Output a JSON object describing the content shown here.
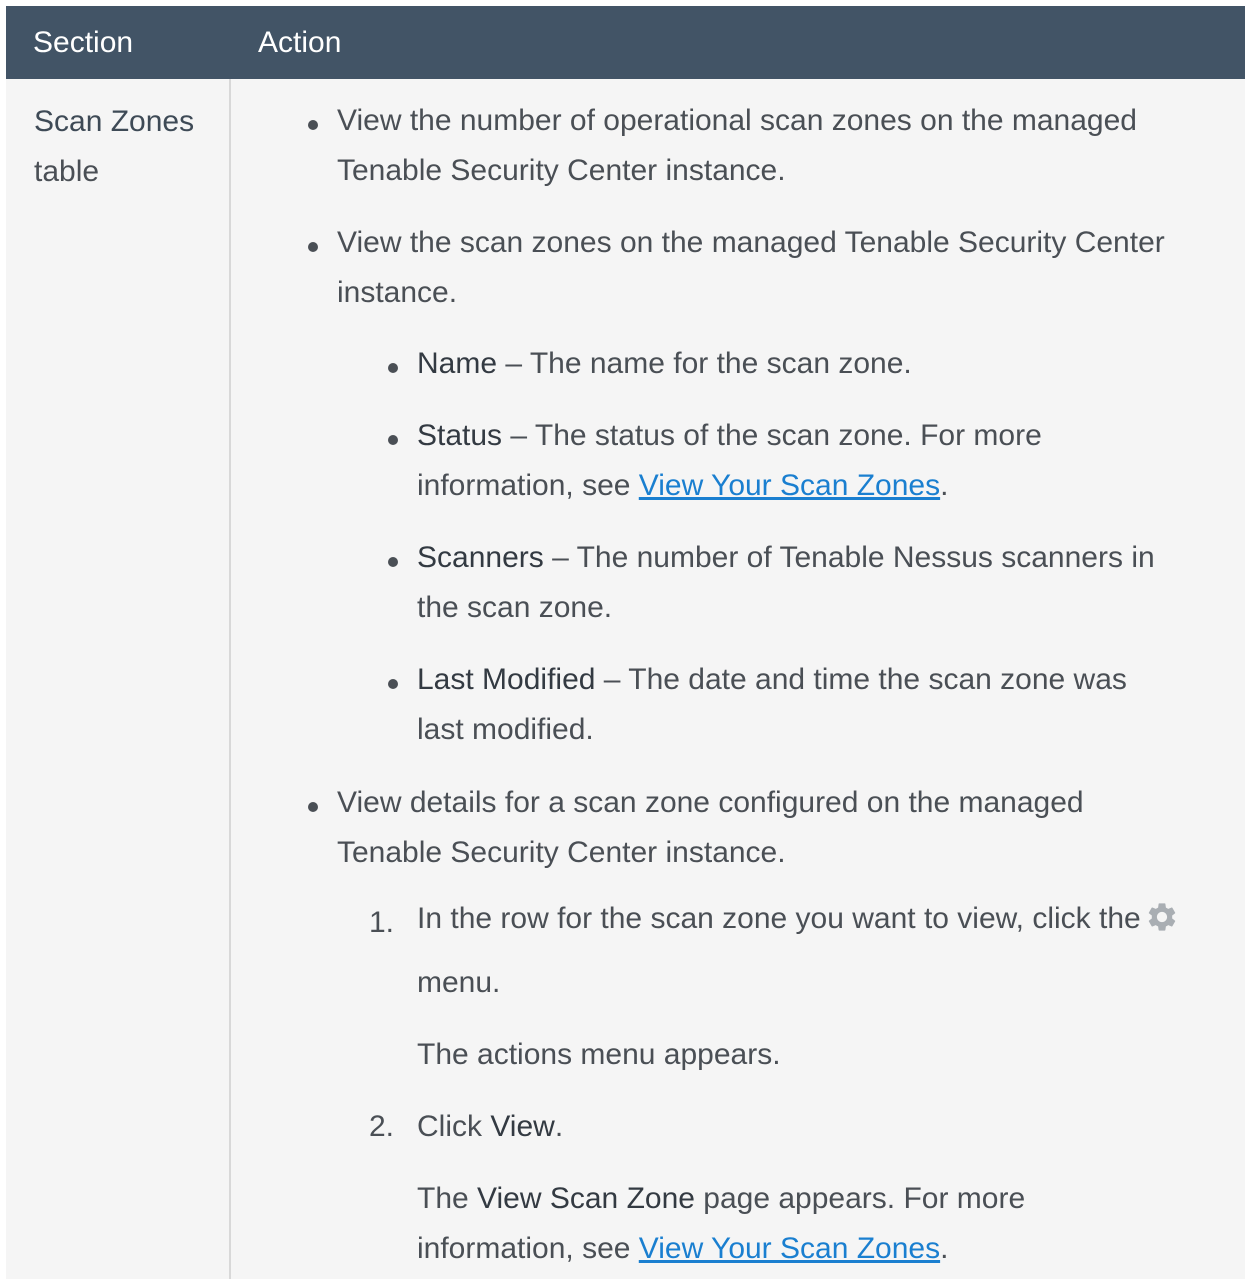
{
  "table": {
    "header": {
      "section": "Section",
      "action": "Action"
    },
    "section": {
      "bold": "Scan Zones",
      "normal": "table"
    },
    "items": {
      "view_count": {
        "line1": "View the number of operational scan zones on the managed",
        "line2": "Tenable Security Center instance."
      },
      "view_zones": {
        "line1": "View the scan zones on the managed Tenable Security Center",
        "line2": "instance."
      },
      "fields": [
        {
          "name": "Name",
          "desc": " – The name for the scan zone."
        },
        {
          "name": "Status",
          "desc": " – The status of the scan zone. For more",
          "line2_prefix": "information, see ",
          "link": "View Your Scan Zones",
          "line2_suffix": "."
        },
        {
          "name": "Scanners",
          "desc": " – The number of Tenable Nessus scanners in",
          "line2": "the scan zone."
        },
        {
          "name": "Last Modified",
          "desc": " – The date and time the scan zone was",
          "line2": "last modified."
        }
      ],
      "view_details": {
        "line1": "View details for a scan zone configured on the managed",
        "line2": "Tenable Security Center instance."
      },
      "steps": [
        {
          "num": "1.",
          "line1": "In the row for the scan zone you want to view, click the",
          "icon": "gear-icon",
          "line2": "menu.",
          "result": "The actions menu appears."
        },
        {
          "num": "2.",
          "prefix": "Click ",
          "bold": "View",
          "suffix": ".",
          "result_prefix": "The ",
          "result_bold": "View Scan Zone",
          "result_suffix": " page appears. For more",
          "result_line2_prefix": "information, see ",
          "result_link": "View Your Scan Zones",
          "result_line2_suffix": "."
        }
      ]
    }
  }
}
